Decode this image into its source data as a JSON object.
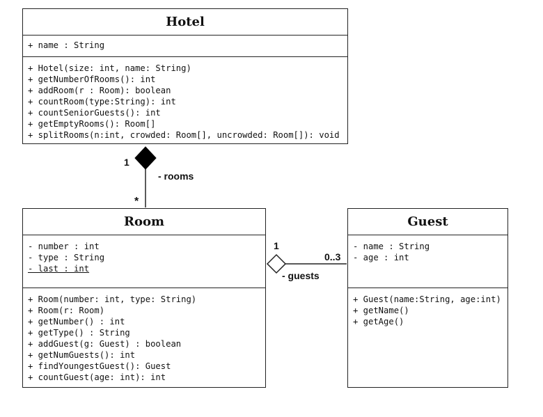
{
  "diagram": {
    "type": "UML class diagram",
    "classes": {
      "hotel": {
        "name": "Hotel",
        "attributes": [
          {
            "text": "+ name : String",
            "static": false
          }
        ],
        "methods": [
          "+ Hotel(size: int, name: String)",
          "+ getNumberOfRooms(): int",
          "+ addRoom(r : Room): boolean",
          "+ countRoom(type:String): int",
          "+ countSeniorGuests(): int",
          "+ getEmptyRooms(): Room[]",
          "+ splitRooms(n:int, crowded: Room[], uncrowded: Room[]): void"
        ]
      },
      "room": {
        "name": "Room",
        "attributes": [
          {
            "text": "- number : int",
            "static": false
          },
          {
            "text": "- type : String",
            "static": false
          },
          {
            "text": "- last : int",
            "static": true
          }
        ],
        "methods": [
          "+ Room(number: int, type: String)",
          "+ Room(r: Room)",
          "+ getNumber() : int",
          "+ getType() : String",
          "+ addGuest(g: Guest) : boolean",
          "+ getNumGuests(): int",
          "+ findYoungestGuest(): Guest",
          "+ countGuest(age: int): int"
        ]
      },
      "guest": {
        "name": "Guest",
        "attributes": [
          {
            "text": "- name : String",
            "static": false
          },
          {
            "text": "- age : int",
            "static": false
          }
        ],
        "methods": [
          "+ Guest(name:String, age:int)",
          "+ getName()",
          "+ getAge()"
        ]
      }
    },
    "relationships": [
      {
        "kind": "composition",
        "from": "Hotel",
        "to": "Room",
        "role": "- rooms",
        "whole_multiplicity": "1",
        "part_multiplicity": "*"
      },
      {
        "kind": "aggregation",
        "from": "Room",
        "to": "Guest",
        "role": "- guests",
        "whole_multiplicity": "1",
        "part_multiplicity": "0..3"
      }
    ]
  }
}
